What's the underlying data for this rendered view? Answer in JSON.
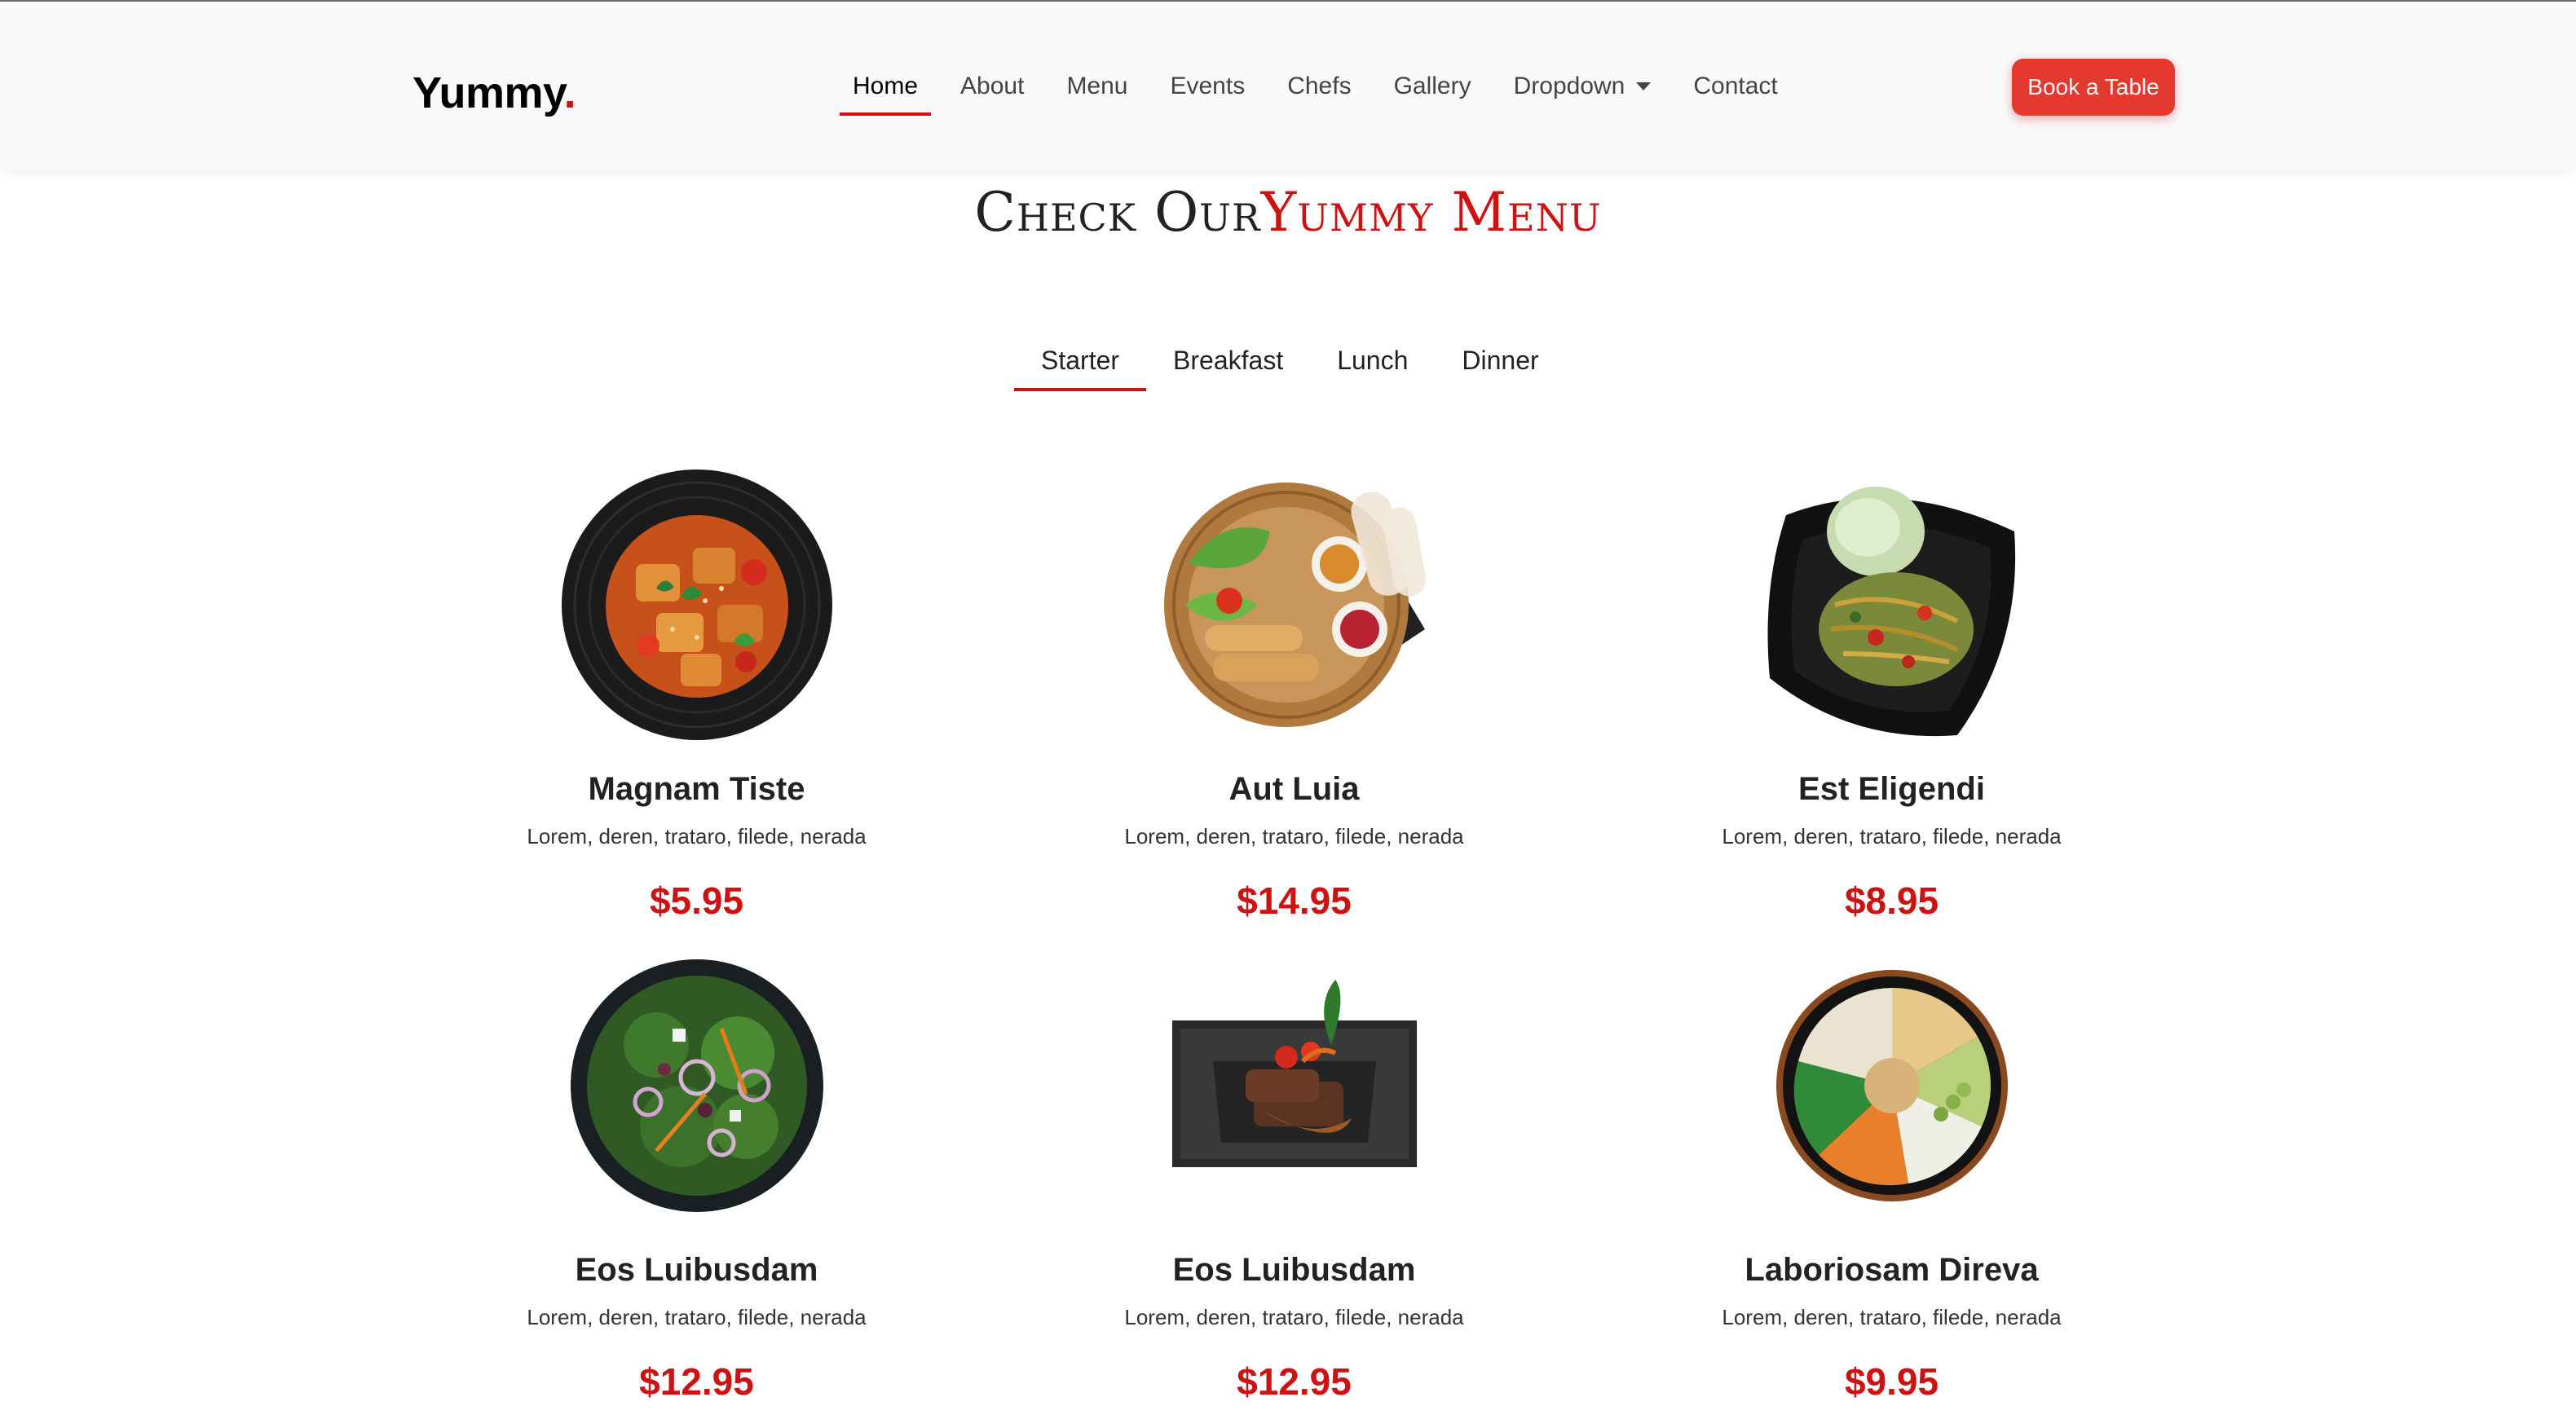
{
  "header": {
    "logo_text": "Yummy",
    "logo_dot": ".",
    "nav": [
      "Home",
      "About",
      "Menu",
      "Events",
      "Chefs",
      "Gallery",
      "Dropdown",
      "Contact"
    ],
    "active_nav": "Home",
    "cta_label": "Book a Table"
  },
  "section": {
    "title_prefix": "Check Our",
    "title_accent": "Yummy Menu"
  },
  "tabs": [
    "Starter",
    "Breakfast",
    "Lunch",
    "Dinner"
  ],
  "active_tab": "Starter",
  "menu_items": [
    {
      "name": "Magnam Tiste",
      "desc": "Lorem, deren, trataro, filede, nerada",
      "price": "$5.95",
      "image": "round-plate-tofu-icon"
    },
    {
      "name": "Aut Luia",
      "desc": "Lorem, deren, trataro, filede, nerada",
      "price": "$14.95",
      "image": "basket-platter-icon"
    },
    {
      "name": "Est Eligendi",
      "desc": "Lorem, deren, trataro, filede, nerada",
      "price": "$8.95",
      "image": "square-plate-noodles-icon"
    },
    {
      "name": "Eos Luibusdam",
      "desc": "Lorem, deren, trataro, filede, nerada",
      "price": "$12.95",
      "image": "round-plate-salad-icon"
    },
    {
      "name": "Eos Luibusdam",
      "desc": "Lorem, deren, trataro, filede, nerada",
      "price": "$12.95",
      "image": "slate-plate-steak-icon"
    },
    {
      "name": "Laboriosam Direva",
      "desc": "Lorem, deren, trataro, filede, nerada",
      "price": "$9.95",
      "image": "round-bowl-mixed-icon"
    }
  ],
  "colors": {
    "accent": "#ce1212",
    "button": "#e4392f",
    "header_bg": "#f8f9fa"
  }
}
